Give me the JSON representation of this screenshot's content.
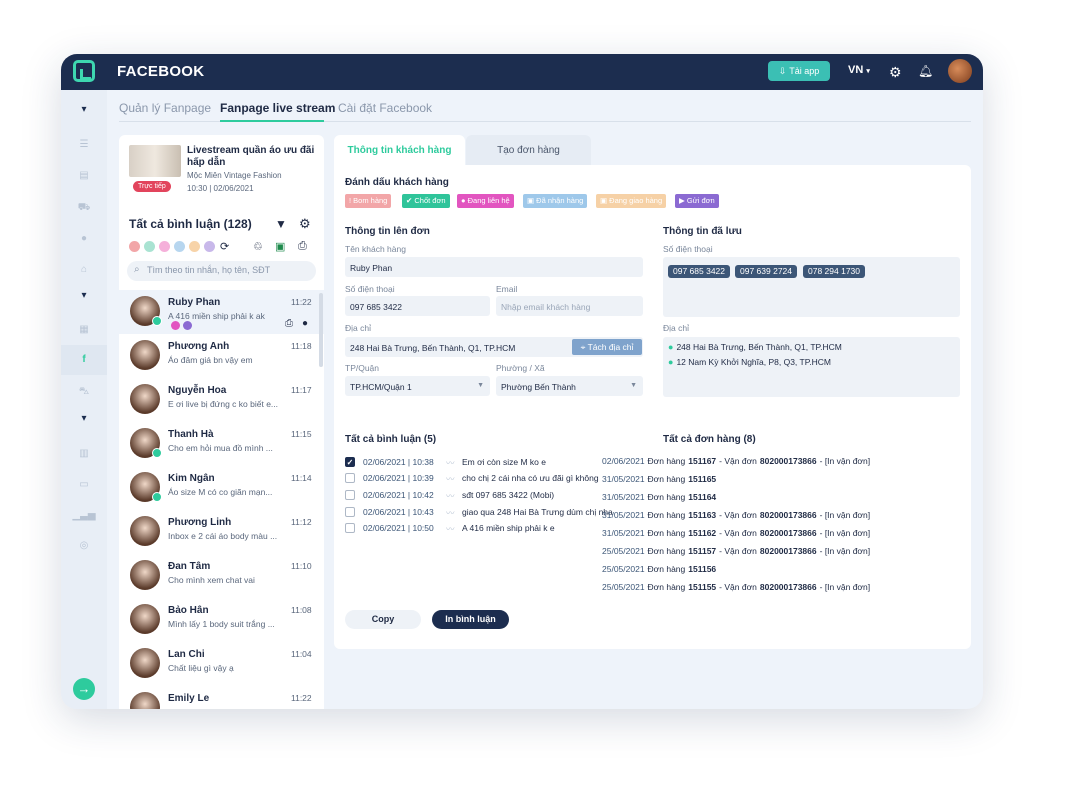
{
  "app": {
    "title": "FACEBOOK",
    "tai_app": "Tải app",
    "lang": "VN"
  },
  "tabs": {
    "t1": "Quản lý Fanpage",
    "t2": "Fanpage live stream",
    "t3": "Cài đặt Facebook"
  },
  "live": {
    "title": "Livestream quần áo ưu đãi hấp dẫn",
    "shop": "Mộc Miên Vintage Fashion",
    "badge": "Trực tiếp",
    "time": "10:30 | 02/06/2021"
  },
  "comments": {
    "title": "Tất cả bình luận (128)",
    "search_placeholder": "Tìm theo tin nhắn, họ tên, SĐT"
  },
  "list": [
    {
      "name": "Ruby Phan",
      "msg": "A 416 miền ship phải k ak",
      "time": "11:22"
    },
    {
      "name": "Phương Anh",
      "msg": "Áo đâm giá bn vậy em",
      "time": "11:18"
    },
    {
      "name": "Nguyễn Hoa",
      "msg": "E ơi live bị đứng c ko biết e...",
      "time": "11:17"
    },
    {
      "name": "Thanh Hà",
      "msg": "Cho em hỏi mua đồ mình ...",
      "time": "11:15"
    },
    {
      "name": "Kim Ngân",
      "msg": "Áo size M có co giãn mạn...",
      "time": "11:14"
    },
    {
      "name": "Phương Linh",
      "msg": "Inbox e 2 cái áo body màu ...",
      "time": "11:12"
    },
    {
      "name": "Đan Tâm",
      "msg": "Cho mình xem chat vai",
      "time": "11:10"
    },
    {
      "name": "Bảo Hân",
      "msg": "Mình lấy 1 body suit trắng ...",
      "time": "11:08"
    },
    {
      "name": "Lan Chi",
      "msg": "Chất liệu gì vậy ạ",
      "time": "11:04"
    },
    {
      "name": "Emily Le",
      "msg": "",
      "time": "11:22"
    }
  ],
  "rtabs": {
    "t1": "Thông tin khách hàng",
    "t2": "Tạo đơn hàng"
  },
  "mark": {
    "title": "Đánh dấu khách hàng",
    "tags": [
      "! Bom hàng",
      "✔ Chốt đơn",
      "● Đang liên hệ",
      "▣ Đã nhận hàng",
      "▣ Đang giao hàng",
      "▶ Gửi đơn"
    ]
  },
  "order_info": {
    "title": "Thông tin lên đơn",
    "name_label": "Tên khách hàng",
    "name": "Ruby Phan",
    "phone_label": "Số điện thoại",
    "phone": "097 685 3422",
    "email_label": "Email",
    "email_placeholder": "Nhập email khách hàng",
    "addr_label": "Địa chỉ",
    "addr": "248 Hai Bà Trưng, Bến Thành, Q1, TP.HCM",
    "split": "Tách địa chỉ",
    "city_label": "TP/Quận",
    "city": "TP.HCM/Quận 1",
    "ward_label": "Phường / Xã",
    "ward": "Phường Bến Thành"
  },
  "saved": {
    "title": "Thông tin đã lưu",
    "phone_label": "Số điện thoại",
    "phones": [
      "097 685 3422",
      "097 639 2724",
      "078 294 1730"
    ],
    "addr_label": "Địa chỉ",
    "addrs": [
      "248 Hai Bà Trưng, Bến Thành, Q1, TP.HCM",
      "12 Nam Kỳ Khởi Nghĩa, P8, Q3, TP.HCM"
    ]
  },
  "cmts": {
    "title": "Tất cả bình luận (5)",
    "rows": [
      {
        "date": "02/06/2021 | 10:38",
        "text": "Em ơi còn size M ko e"
      },
      {
        "date": "02/06/2021 | 10:39",
        "text": "cho chị 2 cái nha có ưu đãi gì không"
      },
      {
        "date": "02/06/2021 | 10:42",
        "text": "sđt 097 685 3422 (Mobi)"
      },
      {
        "date": "02/06/2021 | 10:43",
        "text": "giao qua 248 Hai Bà Trưng dùm chị nha"
      },
      {
        "date": "02/06/2021 | 10:50",
        "text": "A 416 miền ship phải k e"
      }
    ]
  },
  "orders": {
    "title": "Tất cả đơn hàng (8)",
    "rows": [
      {
        "date": "02/06/2021",
        "label": "Đơn hàng",
        "num": "151167",
        "ship_label": "- Vận đơn",
        "ship": "802000173866",
        "print": "- [In vận đơn]"
      },
      {
        "date": "31/05/2021",
        "label": "Đơn hàng",
        "num": "151165",
        "ship_label": "",
        "ship": "",
        "print": ""
      },
      {
        "date": "31/05/2021",
        "label": "Đơn hàng",
        "num": "151164",
        "ship_label": "",
        "ship": "",
        "print": ""
      },
      {
        "date": "31/05/2021",
        "label": "Đơn hàng",
        "num": "151163",
        "ship_label": "- Vận đơn",
        "ship": "802000173866",
        "print": "- [In vận đơn]"
      },
      {
        "date": "31/05/2021",
        "label": "Đơn hàng",
        "num": "151162",
        "ship_label": "- Vận đơn",
        "ship": "802000173866",
        "print": "- [In vận đơn]"
      },
      {
        "date": "25/05/2021",
        "label": "Đơn hàng",
        "num": "151157",
        "ship_label": "- Vận đơn",
        "ship": "802000173866",
        "print": "- [In vận đơn]"
      },
      {
        "date": "25/05/2021",
        "label": "Đơn hàng",
        "num": "151156",
        "ship_label": "",
        "ship": "",
        "print": ""
      },
      {
        "date": "25/05/2021",
        "label": "Đơn hàng",
        "num": "151155",
        "ship_label": "- Vận đơn",
        "ship": "802000173866",
        "print": "- [In vận đơn]"
      }
    ]
  },
  "buttons": {
    "copy": "Copy",
    "print": "In bình luận"
  },
  "colors": {
    "accent": "#2ecb9d",
    "navy": "#1c2d4f"
  }
}
